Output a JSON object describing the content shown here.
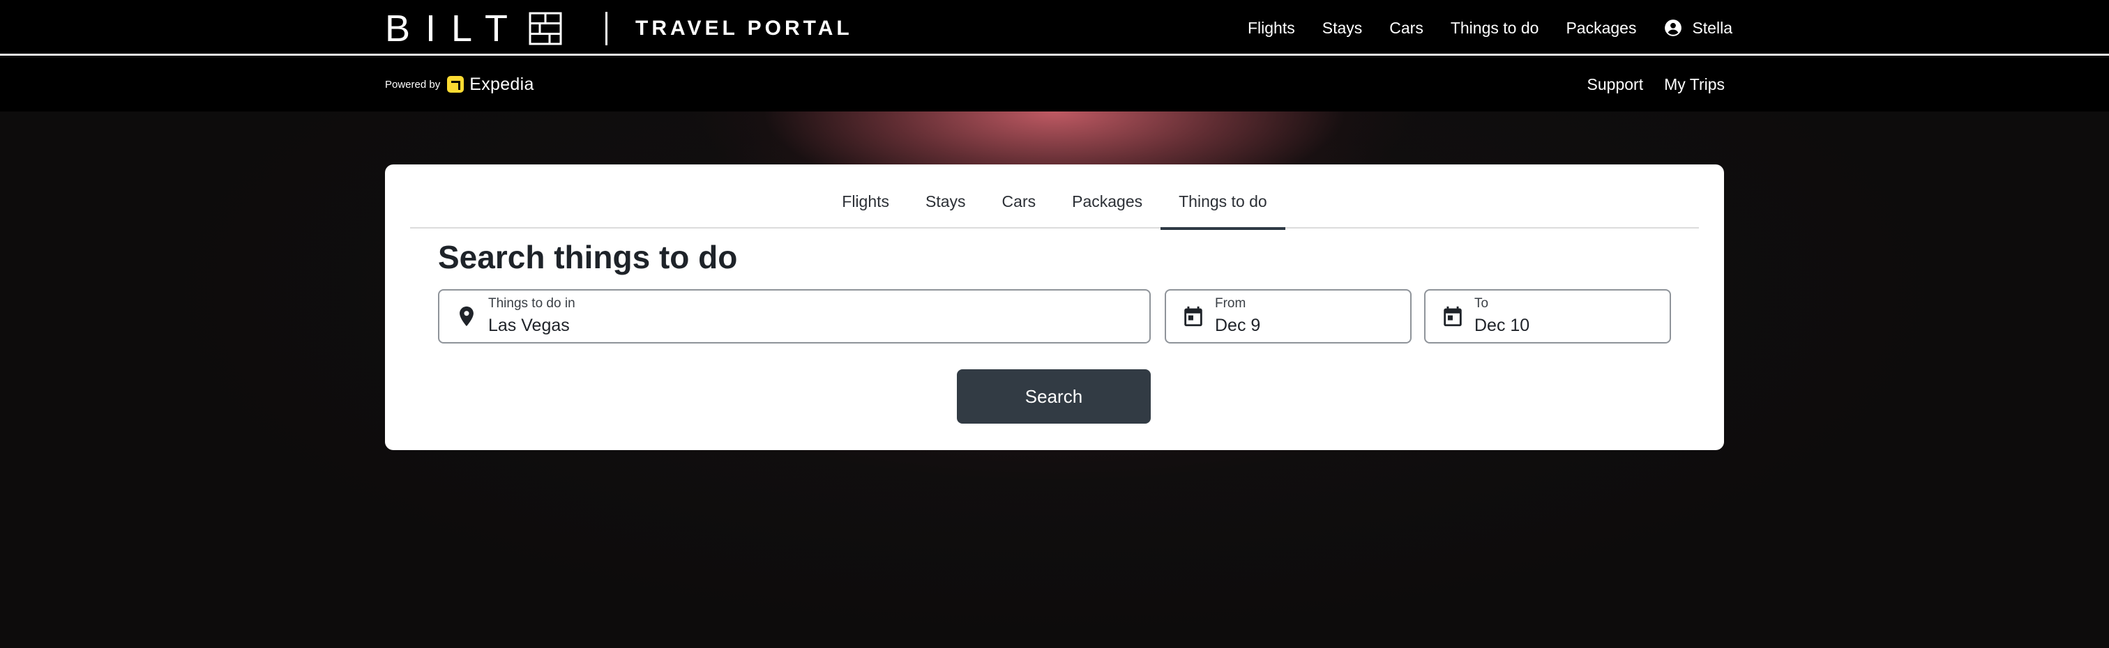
{
  "brand": {
    "wordmark": "BILT",
    "portal_label": "TRAVEL PORTAL",
    "mark_icon": "bilt-grid-icon"
  },
  "topnav": {
    "items": [
      "Flights",
      "Stays",
      "Cars",
      "Things to do",
      "Packages"
    ],
    "user_name": "Stella",
    "user_icon": "account-circle-icon"
  },
  "subbar": {
    "powered_by": "Powered by",
    "partner_name": "Expedia",
    "links": [
      "Support",
      "My Trips"
    ]
  },
  "search": {
    "tabs": [
      "Flights",
      "Stays",
      "Cars",
      "Packages",
      "Things to do"
    ],
    "active_tab": "Things to do",
    "title": "Search things to do",
    "destination": {
      "label": "Things to do in",
      "value": "Las Vegas",
      "icon": "map-pin-icon"
    },
    "from": {
      "label": "From",
      "value": "Dec 9",
      "icon": "calendar-icon"
    },
    "to": {
      "label": "To",
      "value": "Dec 10",
      "icon": "calendar-icon"
    },
    "button_label": "Search"
  },
  "colors": {
    "topbar_bg": "#000000",
    "accent_glow": "#c95e68",
    "button_bg": "#323b44",
    "expedia_yellow": "#fddb32"
  }
}
